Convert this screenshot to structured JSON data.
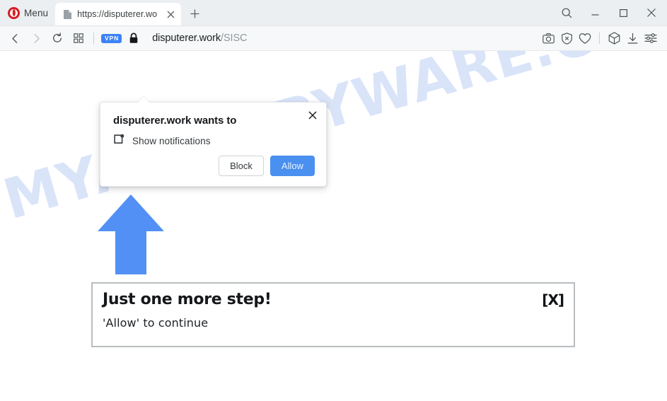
{
  "browser": {
    "menu_label": "Menu",
    "logo_icon": "opera-logo-icon",
    "tab": {
      "title": "https://disputerer.wo",
      "favicon_icon": "page-favicon-icon",
      "close_icon": "tab-close-icon"
    },
    "new_tab_icon": "plus-icon",
    "window_controls": [
      {
        "name": "search-button",
        "icon": "search-icon"
      },
      {
        "name": "minimize-button",
        "icon": "minimize-icon"
      },
      {
        "name": "maximize-button",
        "icon": "maximize-icon"
      },
      {
        "name": "close-window-button",
        "icon": "close-icon"
      }
    ],
    "navigation": {
      "back_icon": "chevron-left-icon",
      "forward_icon": "chevron-right-icon",
      "reload_icon": "reload-icon",
      "apps_icon": "grid-apps-icon"
    },
    "address_bar": {
      "vpn_badge": "VPN",
      "lock_icon": "lock-icon",
      "url_host": "disputerer.work",
      "url_path": "/SISC"
    },
    "toolbar_right": [
      {
        "name": "snapshot-button",
        "icon": "camera-icon"
      },
      {
        "name": "ad-blocker-button",
        "icon": "shield-x-icon"
      },
      {
        "name": "favorites-button",
        "icon": "heart-icon"
      },
      {
        "name": "player-button",
        "icon": "cube-icon"
      },
      {
        "name": "downloads-button",
        "icon": "download-icon"
      },
      {
        "name": "easy-setup-button",
        "icon": "sliders-icon"
      }
    ]
  },
  "permission_popup": {
    "title": "disputerer.work wants to",
    "permission_icon": "show-notifications-icon",
    "permission_label": "Show notifications",
    "block_label": "Block",
    "allow_label": "Allow",
    "close_icon": "close-icon"
  },
  "page": {
    "watermark": "MYANTISPYWARE.COM",
    "arrow_icon": "up-arrow-icon",
    "content_box": {
      "heading": "Just one more step!",
      "subtext": "'Allow' to continue",
      "close_label": "[X]"
    }
  },
  "colors": {
    "accent_blue": "#4a90f0",
    "arrow_blue": "#5390f5",
    "vpn_blue": "#3b82f6",
    "opera_red": "#d71c23",
    "watermark_blue": "#cfddf8"
  }
}
